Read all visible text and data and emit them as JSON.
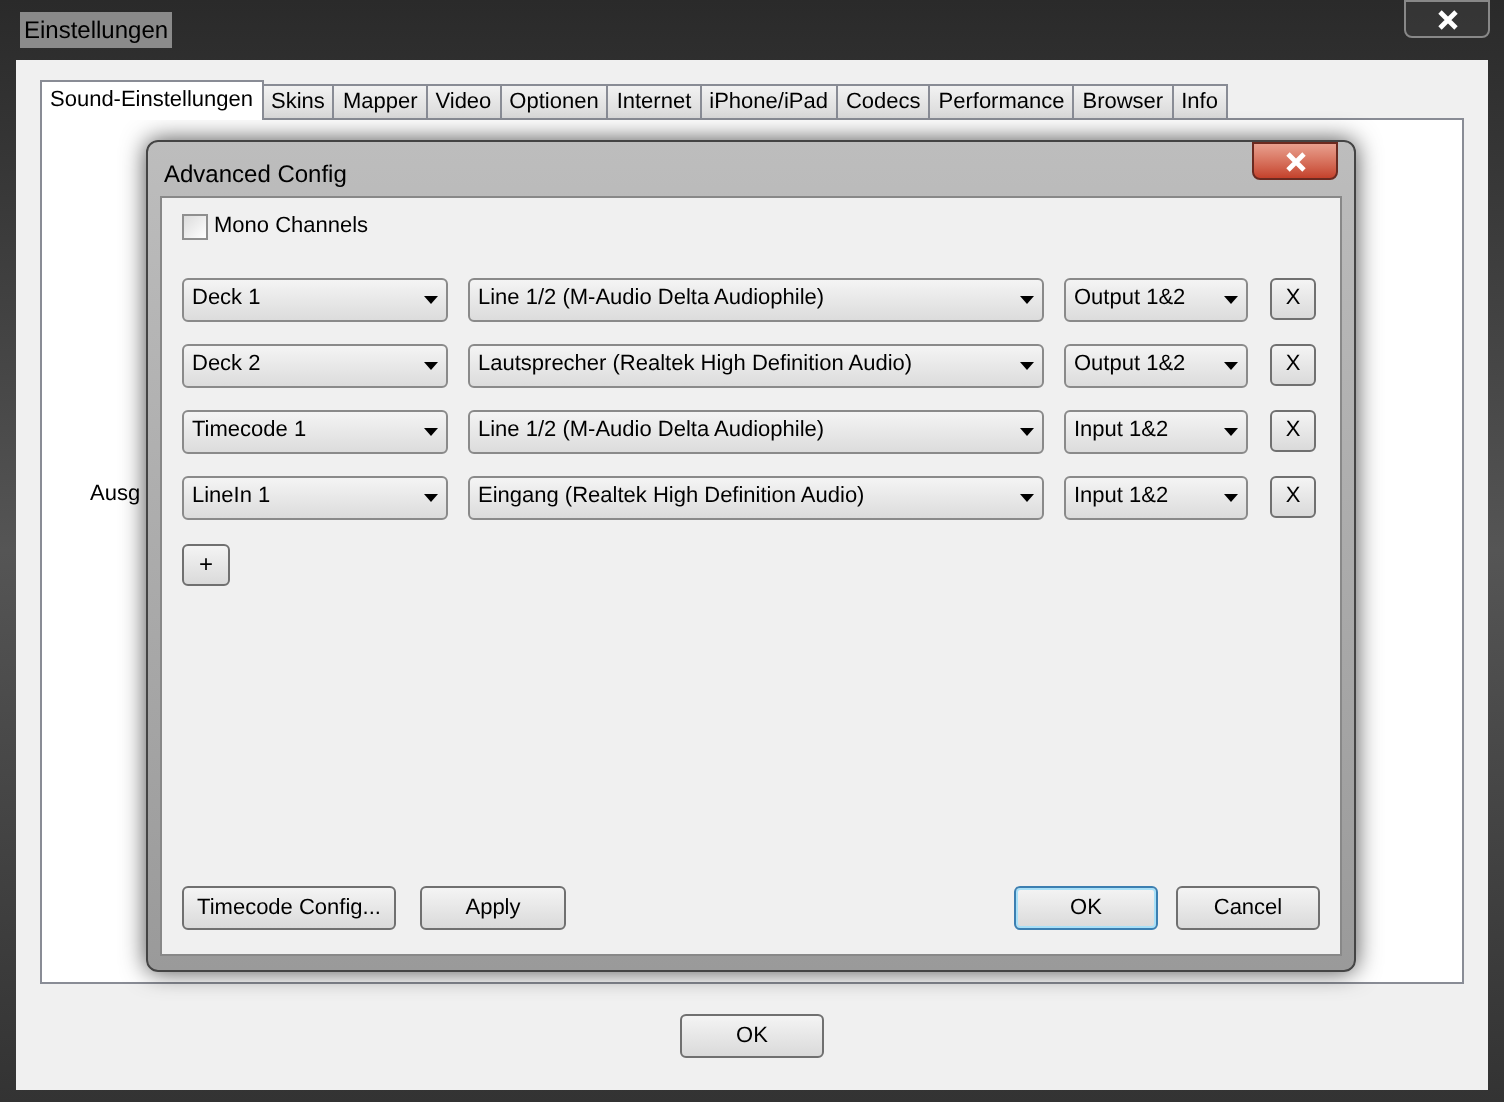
{
  "window": {
    "title": "Einstellungen"
  },
  "tabs": [
    {
      "label": "Sound-Einstellungen",
      "selected": true
    },
    {
      "label": "Skins",
      "selected": false
    },
    {
      "label": "Mapper",
      "selected": false
    },
    {
      "label": "Video",
      "selected": false
    },
    {
      "label": "Optionen",
      "selected": false
    },
    {
      "label": "Internet",
      "selected": false
    },
    {
      "label": "iPhone/iPad",
      "selected": false
    },
    {
      "label": "Codecs",
      "selected": false
    },
    {
      "label": "Performance",
      "selected": false
    },
    {
      "label": "Browser",
      "selected": false
    },
    {
      "label": "Info",
      "selected": false
    }
  ],
  "panel_label": "Ausg",
  "dialog": {
    "title": "Advanced Config",
    "mono_channels": {
      "label": "Mono Channels",
      "checked": false
    },
    "rows": [
      {
        "channel": "Deck 1",
        "device": "Line 1/2 (M-Audio Delta Audiophile)",
        "port": "Output 1&2",
        "remove": "X"
      },
      {
        "channel": "Deck 2",
        "device": "Lautsprecher (Realtek High Definition Audio)",
        "port": "Output 1&2",
        "remove": "X"
      },
      {
        "channel": "Timecode 1",
        "device": "Line 1/2 (M-Audio Delta Audiophile)",
        "port": "Input 1&2",
        "remove": "X"
      },
      {
        "channel": "LineIn 1",
        "device": "Eingang (Realtek High Definition Audio)",
        "port": "Input 1&2",
        "remove": "X"
      }
    ],
    "add": "+",
    "buttons": [
      {
        "label": "Timecode Config...",
        "default": false
      },
      {
        "label": "Apply",
        "default": false
      },
      {
        "label": "OK",
        "default": true
      },
      {
        "label": "Cancel",
        "default": false
      }
    ]
  },
  "ok": "OK"
}
